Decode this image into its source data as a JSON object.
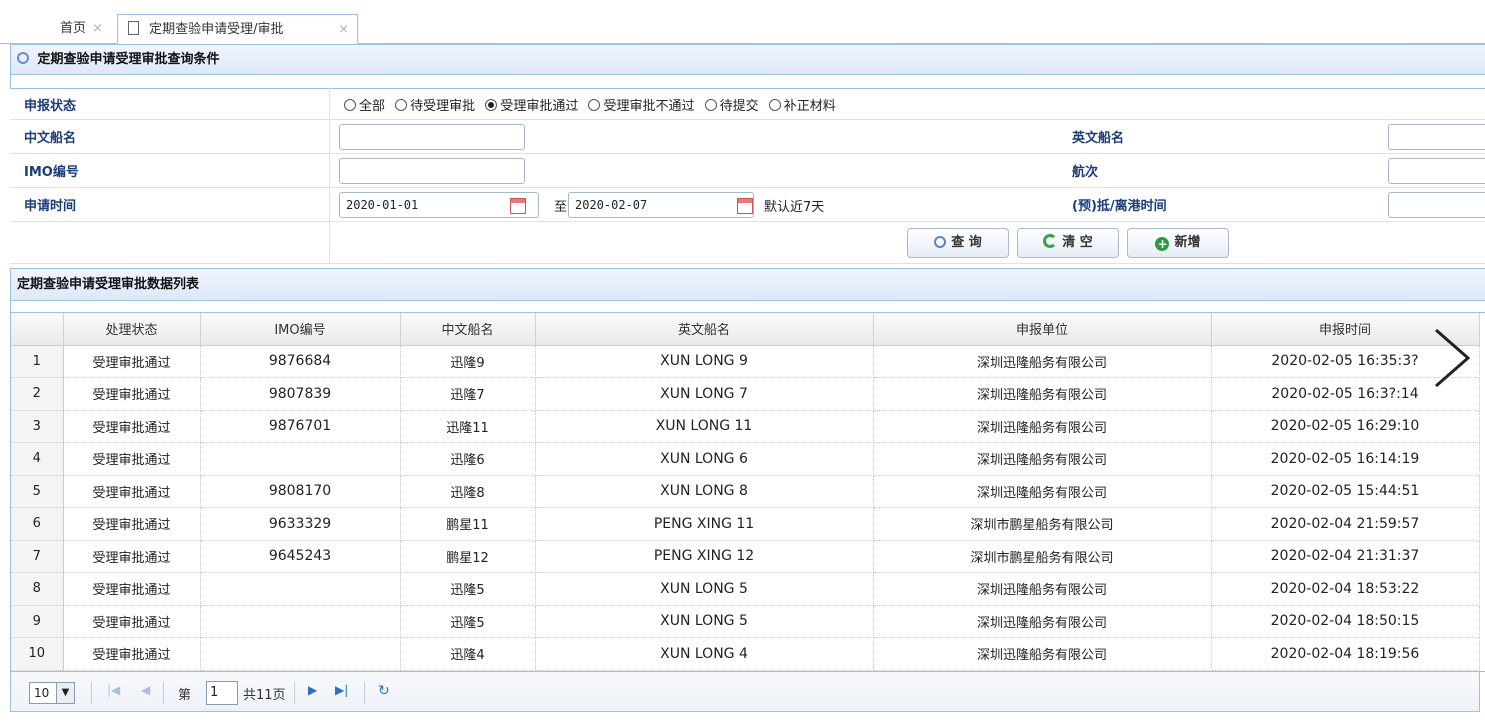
{
  "tabs": [
    {
      "label": "首页",
      "close": "×"
    },
    {
      "label": "定期查验申请受理/审批",
      "close": "×"
    }
  ],
  "query_panel": {
    "title": "定期查验申请受理审批查询条件",
    "status_label": "申报状态",
    "status_options": [
      "全部",
      "待受理审批",
      "受理审批通过",
      "受理审批不通过",
      "待提交",
      "补正材料"
    ],
    "status_selected_index": 2,
    "cn_name_label": "中文船名",
    "en_name_label": "英文船名",
    "imo_label": "IMO编号",
    "voyage_label": "航次",
    "apply_time_label": "申请时间",
    "date_from": "2020-01-01",
    "date_to_sep": "至",
    "date_to": "2020-02-07",
    "default_hint": "默认近7天",
    "port_time_label": "(预)抵/离港时间",
    "btn_query": "查 询",
    "btn_clear": "清 空",
    "btn_add": "新增"
  },
  "list_panel": {
    "title": "定期查验申请受理审批数据列表",
    "columns": [
      "处理状态",
      "IMO编号",
      "中文船名",
      "英文船名",
      "申报单位",
      "申报时间"
    ],
    "rows": [
      [
        "1",
        "受理审批通过",
        "9876684",
        "迅隆9",
        "XUN LONG 9",
        "深圳迅隆船务有限公司",
        "2020-02-05 16:35:3?"
      ],
      [
        "2",
        "受理审批通过",
        "9807839",
        "迅隆7",
        "XUN LONG 7",
        "深圳迅隆船务有限公司",
        "2020-02-05 16:3?:14"
      ],
      [
        "3",
        "受理审批通过",
        "9876701",
        "迅隆11",
        "XUN LONG 11",
        "深圳迅隆船务有限公司",
        "2020-02-05 16:29:10"
      ],
      [
        "4",
        "受理审批通过",
        "",
        "迅隆6",
        "XUN LONG 6",
        "深圳迅隆船务有限公司",
        "2020-02-05 16:14:19"
      ],
      [
        "5",
        "受理审批通过",
        "9808170",
        "迅隆8",
        "XUN LONG 8",
        "深圳迅隆船务有限公司",
        "2020-02-05 15:44:51"
      ],
      [
        "6",
        "受理审批通过",
        "9633329",
        "鹏星11",
        "PENG XING 11",
        "深圳市鹏星船务有限公司",
        "2020-02-04 21:59:57"
      ],
      [
        "7",
        "受理审批通过",
        "9645243",
        "鹏星12",
        "PENG XING 12",
        "深圳市鹏星船务有限公司",
        "2020-02-04 21:31:37"
      ],
      [
        "8",
        "受理审批通过",
        "",
        "迅隆5",
        "XUN LONG 5",
        "深圳迅隆船务有限公司",
        "2020-02-04 18:53:22"
      ],
      [
        "9",
        "受理审批通过",
        "",
        "迅隆5",
        "XUN LONG 5",
        "深圳迅隆船务有限公司",
        "2020-02-04 18:50:15"
      ],
      [
        "10",
        "受理审批通过",
        "",
        "迅隆4",
        "XUN LONG 4",
        "深圳迅隆船务有限公司",
        "2020-02-04 18:19:56"
      ]
    ]
  },
  "pager": {
    "page_size": "10",
    "page_prefix": "第",
    "page_current": "1",
    "page_total": "共11页"
  },
  "colors": {
    "border": "#9fc0e6",
    "label_blue": "#1c3d7a",
    "icon_blue": "#2d6fc0"
  },
  "icons": [
    "doc-icon",
    "search-icon",
    "refresh-icon",
    "add-icon",
    "calendar-icon",
    "first-page-icon",
    "prev-page-icon",
    "next-page-icon",
    "last-page-icon",
    "reload-icon",
    "chevron-right-icon"
  ]
}
